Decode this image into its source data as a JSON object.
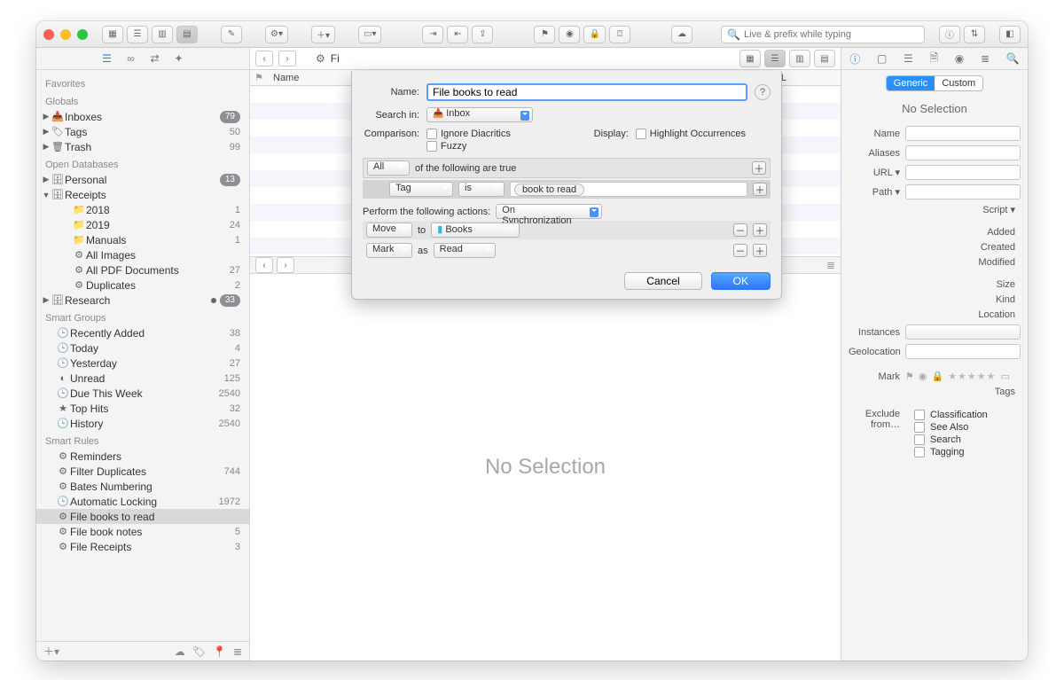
{
  "toolbar": {
    "search_placeholder": "Live & prefix while typing"
  },
  "sidebar": {
    "sections": [
      {
        "header": "Favorites",
        "items": []
      },
      {
        "header": "Globals",
        "items": [
          {
            "icon": "📥",
            "label": "Inboxes",
            "badge": "79",
            "tri": "▶"
          },
          {
            "icon": "🏷",
            "label": "Tags",
            "count": "50",
            "tri": "▶"
          },
          {
            "icon": "🗑",
            "label": "Trash",
            "count": "99",
            "tri": "▶"
          }
        ]
      },
      {
        "header": "Open Databases",
        "items": [
          {
            "icon": "🗄",
            "label": "Personal",
            "badge": "13",
            "tri": "▶"
          },
          {
            "icon": "🗄",
            "label": "Receipts",
            "tri": "▼"
          },
          {
            "icon": "📁",
            "label": "2018",
            "count": "1",
            "indent": 2
          },
          {
            "icon": "📁",
            "label": "2019",
            "count": "24",
            "indent": 2
          },
          {
            "icon": "📁",
            "label": "Manuals",
            "count": "1",
            "indent": 2
          },
          {
            "icon": "⚙",
            "label": "All Images",
            "indent": 2
          },
          {
            "icon": "⚙",
            "label": "All PDF Documents",
            "count": "27",
            "indent": 2
          },
          {
            "icon": "⚙",
            "label": "Duplicates",
            "count": "2",
            "indent": 2
          },
          {
            "icon": "🗄",
            "label": "Research",
            "badge": "33",
            "dot": true,
            "tri": "▶"
          }
        ]
      },
      {
        "header": "Smart Groups",
        "items": [
          {
            "icon": "🕒",
            "label": "Recently Added",
            "count": "38"
          },
          {
            "icon": "🕒",
            "label": "Today",
            "count": "4"
          },
          {
            "icon": "🕒",
            "label": "Yesterday",
            "count": "27"
          },
          {
            "icon": "◐",
            "label": "Unread",
            "count": "125"
          },
          {
            "icon": "🕒",
            "label": "Due This Week",
            "count": "2540"
          },
          {
            "icon": "★",
            "label": "Top Hits",
            "count": "32"
          },
          {
            "icon": "🕒",
            "label": "History",
            "count": "2540"
          }
        ]
      },
      {
        "header": "Smart Rules",
        "items": [
          {
            "icon": "⚙",
            "label": "Reminders"
          },
          {
            "icon": "⚙",
            "label": "Filter Duplicates",
            "count": "744"
          },
          {
            "icon": "⚙",
            "label": "Bates Numbering"
          },
          {
            "icon": "🕒",
            "label": "Automatic Locking",
            "count": "1972"
          },
          {
            "icon": "⚙",
            "label": "File books to read",
            "selected": true
          },
          {
            "icon": "⚙",
            "label": "File book notes",
            "count": "5"
          },
          {
            "icon": "⚙",
            "label": "File Receipts",
            "count": "3"
          }
        ]
      }
    ]
  },
  "main": {
    "columns": {
      "name": "Name",
      "url": "URL"
    },
    "preview_text": "No Selection",
    "gear_label": "Fi"
  },
  "inspector": {
    "seg": {
      "generic": "Generic",
      "custom": "Custom"
    },
    "title": "No Selection",
    "fields": {
      "name": "Name",
      "aliases": "Aliases",
      "url": "URL",
      "path": "Path",
      "script": "Script",
      "added": "Added",
      "created": "Created",
      "modified": "Modified",
      "size": "Size",
      "kind": "Kind",
      "location": "Location",
      "instances": "Instances",
      "geolocation": "Geolocation",
      "mark": "Mark",
      "tags": "Tags",
      "exclude": "Exclude from…"
    },
    "exclude_opts": [
      "Classification",
      "See Also",
      "Search",
      "Tagging"
    ]
  },
  "sheet": {
    "name_label": "Name:",
    "name_value": "File books to read",
    "search_in_label": "Search in:",
    "search_in_value": "Inbox",
    "comparison_label": "Comparison:",
    "ignore_diacritics": "Ignore Diacritics",
    "fuzzy": "Fuzzy",
    "display_label": "Display:",
    "highlight": "Highlight Occurrences",
    "scope": "All",
    "scope_tail": "of the following are true",
    "cond": {
      "field": "Tag",
      "op": "is",
      "value": "book to read"
    },
    "actions_label": "Perform the following actions:",
    "trigger": "On Synchronization",
    "act1": {
      "verb": "Move",
      "prep": "to",
      "dest": "Books"
    },
    "act2": {
      "verb": "Mark",
      "prep": "as",
      "dest": "Read"
    },
    "cancel": "Cancel",
    "ok": "OK"
  }
}
